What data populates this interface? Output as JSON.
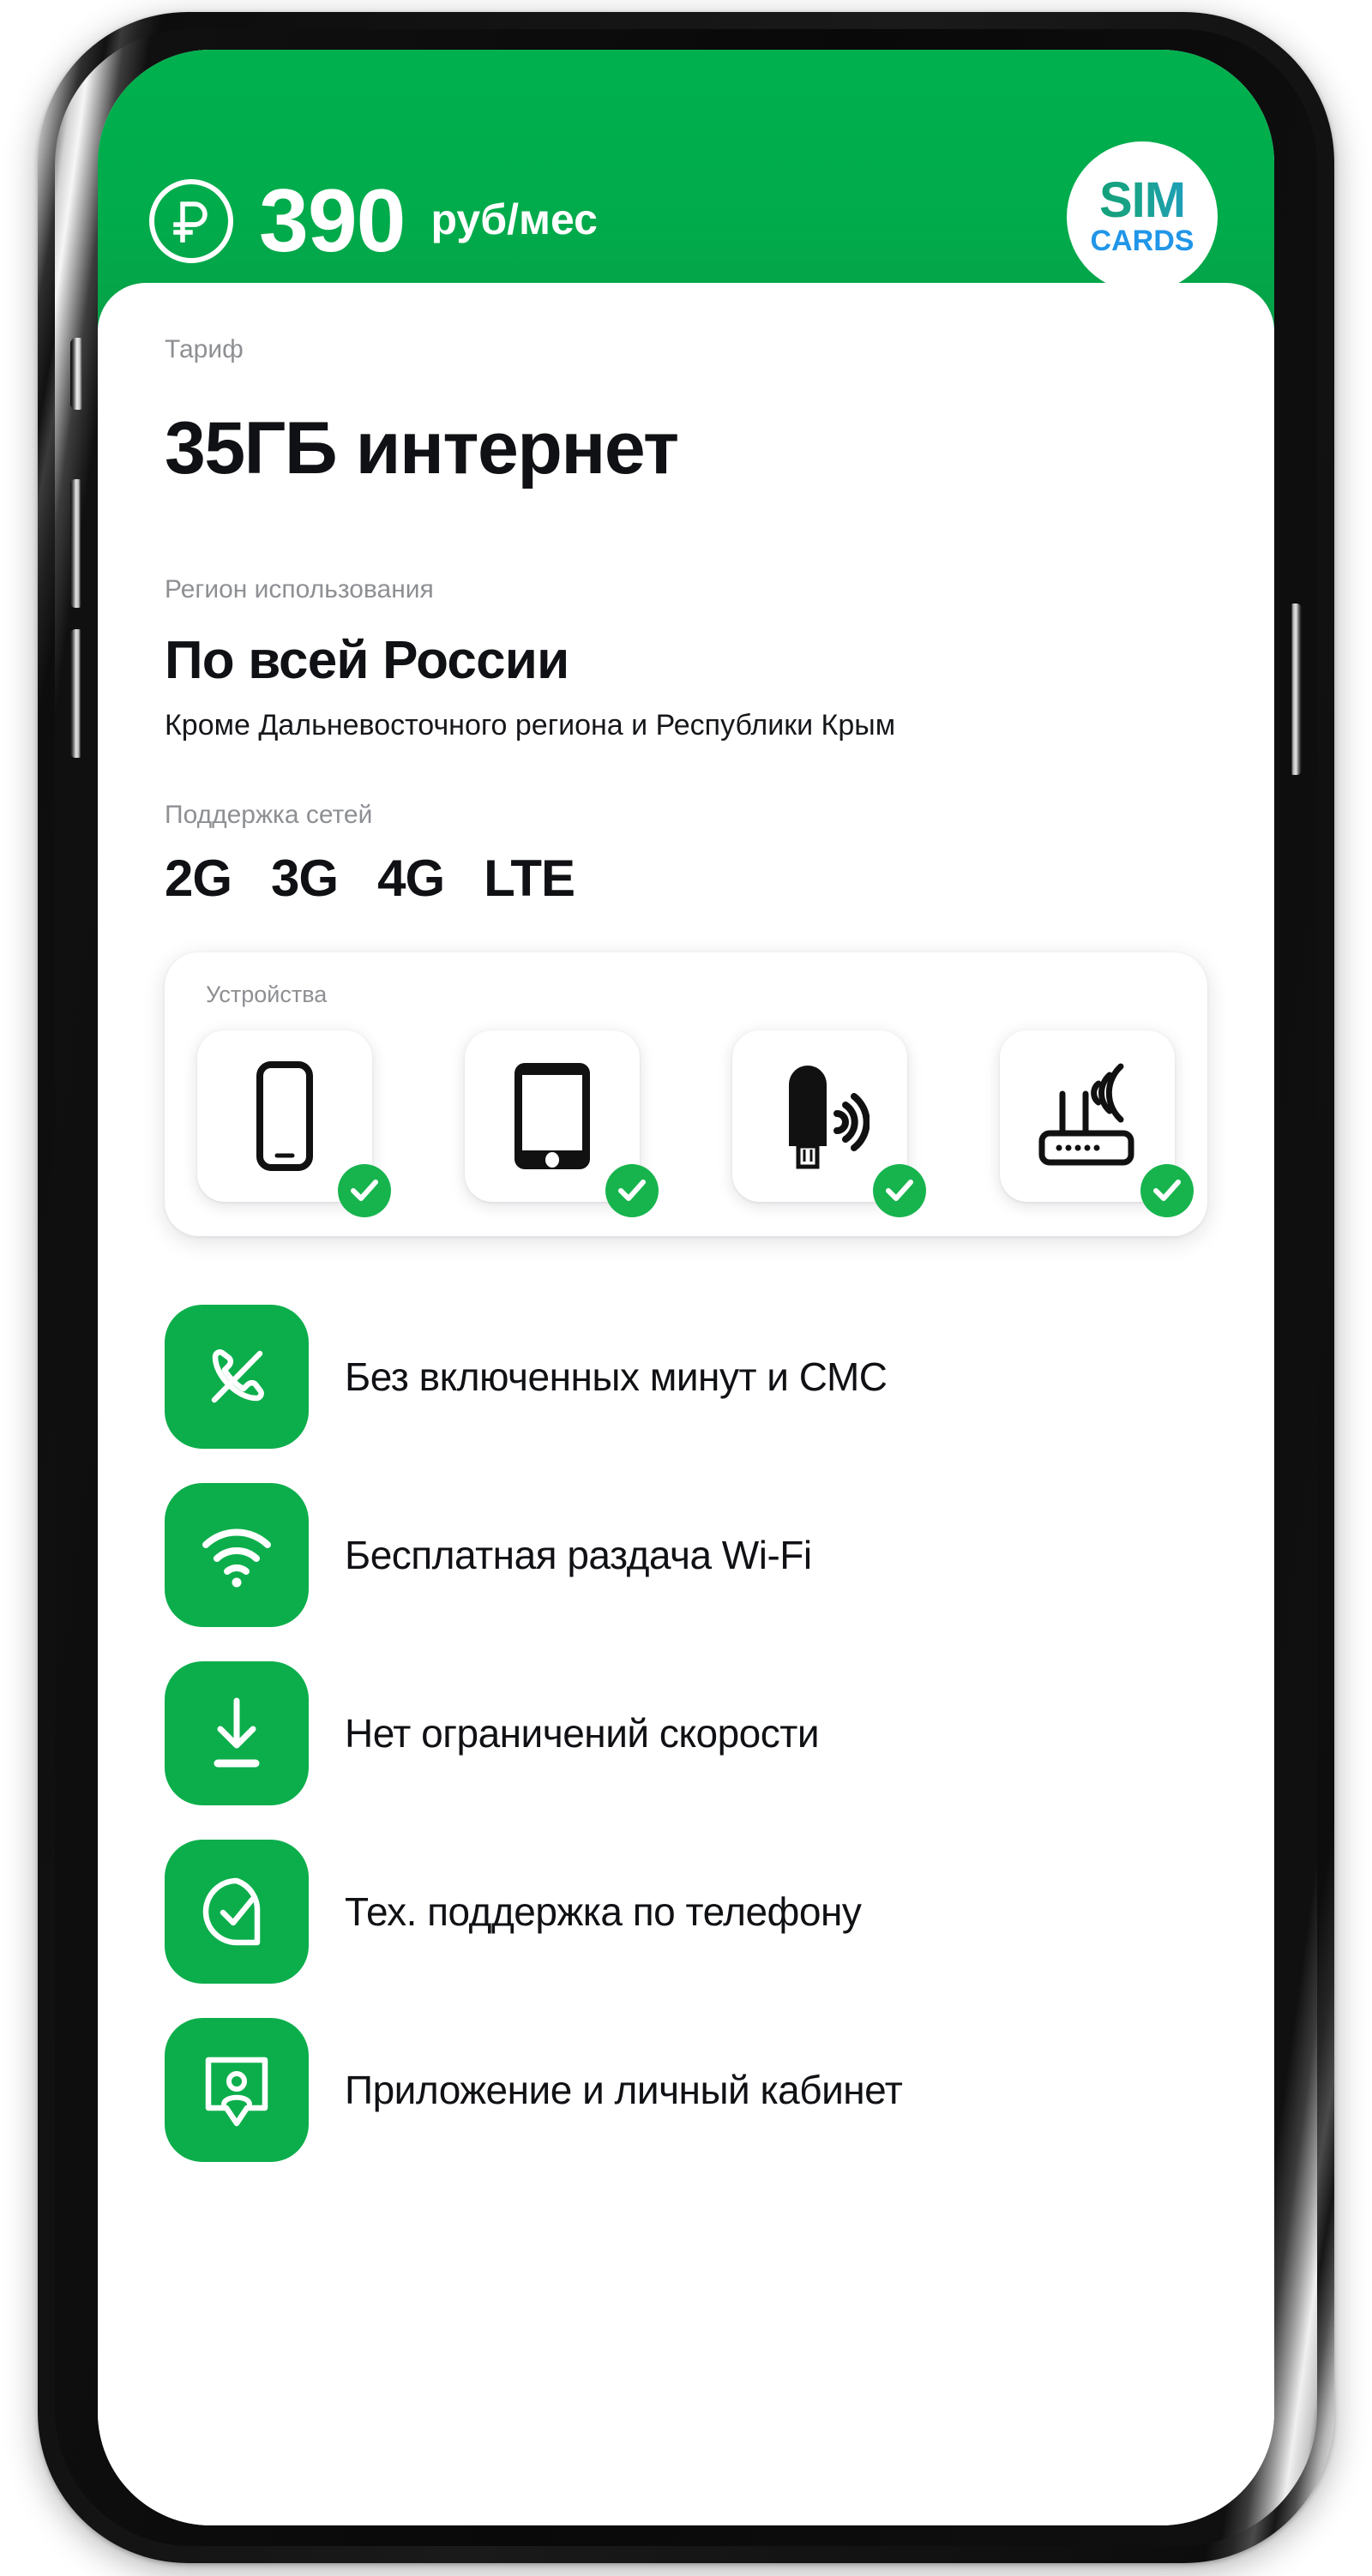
{
  "header": {
    "currency_icon": "ruble-circle-icon",
    "price_amount": "390",
    "price_unit": "руб/мес",
    "brand": {
      "line1": "SIM",
      "line2": "CARDS"
    }
  },
  "tariff": {
    "label": "Тариф",
    "value": "35ГБ интернет"
  },
  "region": {
    "label": "Регион использования",
    "value": "По всей России",
    "note": "Кроме Дальневосточного региона и Республики Крым"
  },
  "networks": {
    "label": "Поддержка сетей",
    "items": [
      "2G",
      "3G",
      "4G",
      "LTE"
    ]
  },
  "devices": {
    "label": "Устройства",
    "items": [
      {
        "icon": "smartphone-outline-icon",
        "supported": true,
        "check_icon": "check-icon"
      },
      {
        "icon": "tablet-icon",
        "supported": true,
        "check_icon": "check-icon"
      },
      {
        "icon": "usb-modem-icon",
        "supported": true,
        "check_icon": "check-icon"
      },
      {
        "icon": "wifi-router-icon",
        "supported": true,
        "check_icon": "check-icon"
      }
    ]
  },
  "features": [
    {
      "icon": "phone-off-icon",
      "label": "Без включенных минут и СМС"
    },
    {
      "icon": "wifi-icon",
      "label": "Бесплатная раздача Wi-Fi"
    },
    {
      "icon": "download-arrow-icon",
      "label": "Нет ограничений скорости"
    },
    {
      "icon": "check-bubble-icon",
      "label": "Тех. поддержка по телефону"
    },
    {
      "icon": "user-card-icon",
      "label": "Приложение и личный кабинет"
    }
  ],
  "colors": {
    "brand_green": "#00AB4B",
    "icon_green": "#0CAE4B",
    "check_green": "#17B44E",
    "label_gray": "#8D8F93",
    "text_dark": "#101114",
    "logo_cards_blue": "#2196E8"
  }
}
